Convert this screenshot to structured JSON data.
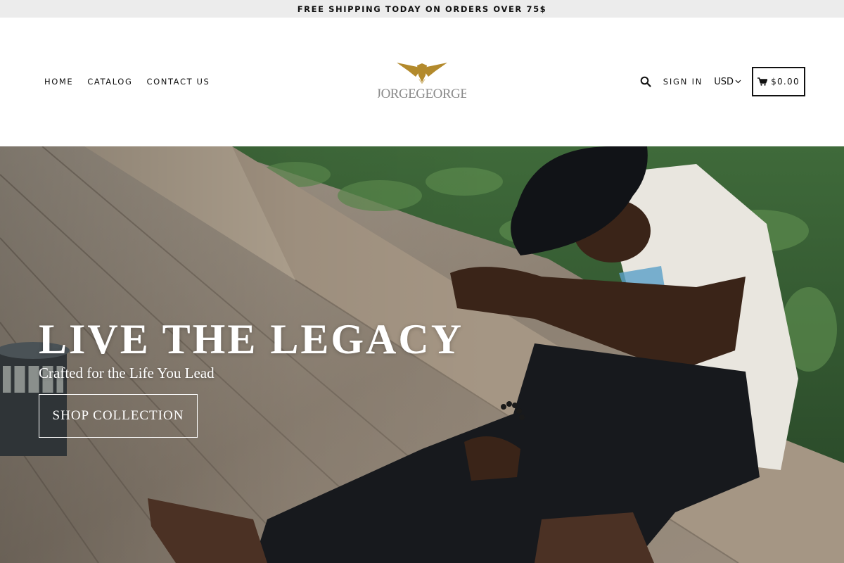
{
  "announcement": {
    "text": "FREE SHIPPING TODAY ON ORDERS OVER 75$"
  },
  "nav": {
    "left": [
      {
        "label": "HOME"
      },
      {
        "label": "CATALOG"
      },
      {
        "label": "CONTACT US"
      }
    ],
    "sign_in": "SIGN IN",
    "currency": "USD",
    "cart_total": "$0.00"
  },
  "logo": {
    "text": "JORGEGEORGE",
    "icon": "eagle-logo-icon",
    "color": "#b38a2c"
  },
  "hero": {
    "title": "LIVE THE LEGACY",
    "subtitle": "Crafted for the Life You Lead",
    "button": "SHOP COLLECTION"
  },
  "icons": {
    "search": "search-icon",
    "cart": "cart-icon",
    "currency_toggle": "chevron-down-icon"
  }
}
